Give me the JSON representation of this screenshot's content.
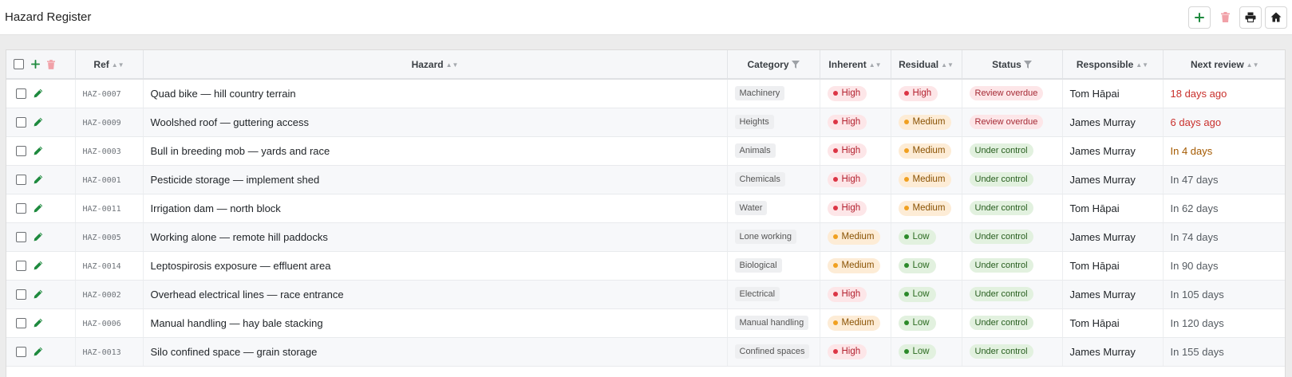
{
  "header": {
    "title": "Hazard Register"
  },
  "columns": {
    "ref": "Ref",
    "hazard": "Hazard",
    "category": "Category",
    "inherent": "Inherent",
    "residual": "Residual",
    "status": "Status",
    "responsible": "Responsible",
    "next_review": "Next review"
  },
  "icons": {
    "add": "plus-icon",
    "delete": "trash-icon",
    "print": "printer-icon",
    "home": "home-icon",
    "edit": "pencil-icon",
    "sort": "sort-icon",
    "filter": "filter-icon"
  },
  "colors": {
    "accent_green": "#1e8a3e",
    "danger_faded": "#f1a1a8",
    "high": "#dc3545",
    "medium": "#f0a020",
    "low": "#2c8a2a"
  },
  "rows": [
    {
      "ref": "HAZ-0007",
      "hazard": "Quad bike — hill country terrain",
      "category": "Machinery",
      "inherent": "High",
      "residual": "High",
      "status": "Review overdue",
      "responsible": "Tom Hāpai",
      "next_review": "18 days ago"
    },
    {
      "ref": "HAZ-0009",
      "hazard": "Woolshed roof — guttering access",
      "category": "Heights",
      "inherent": "High",
      "residual": "Medium",
      "status": "Review overdue",
      "responsible": "James Murray",
      "next_review": "6 days ago"
    },
    {
      "ref": "HAZ-0003",
      "hazard": "Bull in breeding mob — yards and race",
      "category": "Animals",
      "inherent": "High",
      "residual": "Medium",
      "status": "Under control",
      "responsible": "James Murray",
      "next_review": "In 4 days"
    },
    {
      "ref": "HAZ-0001",
      "hazard": "Pesticide storage — implement shed",
      "category": "Chemicals",
      "inherent": "High",
      "residual": "Medium",
      "status": "Under control",
      "responsible": "James Murray",
      "next_review": "In 47 days"
    },
    {
      "ref": "HAZ-0011",
      "hazard": "Irrigation dam — north block",
      "category": "Water",
      "inherent": "High",
      "residual": "Medium",
      "status": "Under control",
      "responsible": "Tom Hāpai",
      "next_review": "In 62 days"
    },
    {
      "ref": "HAZ-0005",
      "hazard": "Working alone — remote hill paddocks",
      "category": "Lone working",
      "inherent": "Medium",
      "residual": "Low",
      "status": "Under control",
      "responsible": "James Murray",
      "next_review": "In 74 days"
    },
    {
      "ref": "HAZ-0014",
      "hazard": "Leptospirosis exposure — effluent area",
      "category": "Biological",
      "inherent": "Medium",
      "residual": "Low",
      "status": "Under control",
      "responsible": "Tom Hāpai",
      "next_review": "In 90 days"
    },
    {
      "ref": "HAZ-0002",
      "hazard": "Overhead electrical lines — race entrance",
      "category": "Electrical",
      "inherent": "High",
      "residual": "Low",
      "status": "Under control",
      "responsible": "James Murray",
      "next_review": "In 105 days"
    },
    {
      "ref": "HAZ-0006",
      "hazard": "Manual handling — hay bale stacking",
      "category": "Manual handling",
      "inherent": "Medium",
      "residual": "Low",
      "status": "Under control",
      "responsible": "Tom Hāpai",
      "next_review": "In 120 days"
    },
    {
      "ref": "HAZ-0013",
      "hazard": "Silo confined space — grain storage",
      "category": "Confined spaces",
      "inherent": "High",
      "residual": "Low",
      "status": "Under control",
      "responsible": "James Murray",
      "next_review": "In 155 days"
    }
  ]
}
